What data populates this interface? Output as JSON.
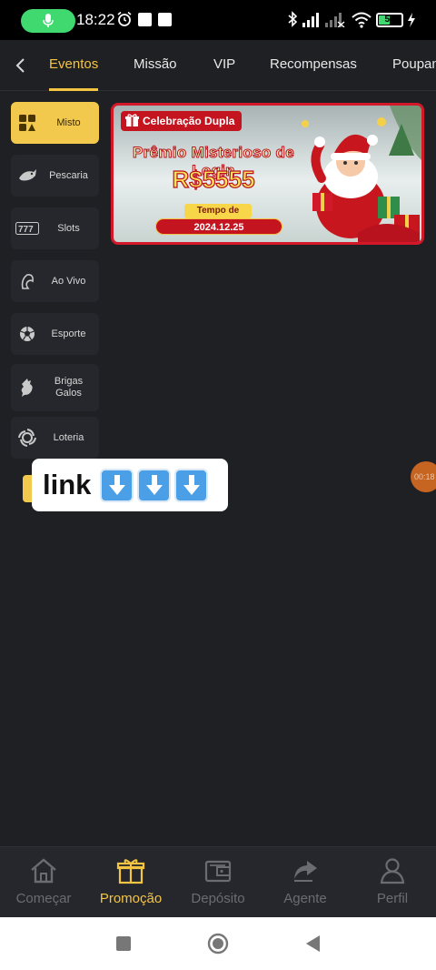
{
  "status_bar": {
    "time": "18:22",
    "battery_level": "50",
    "battery_fraction": 0.5,
    "icons": [
      "microphone-icon",
      "alarm-icon",
      "bluetooth-icon",
      "signal-icon",
      "wifi-icon",
      "charging-icon"
    ]
  },
  "top_nav": {
    "tabs": [
      {
        "label": "Eventos",
        "active": true
      },
      {
        "label": "Missão",
        "active": false
      },
      {
        "label": "VIP",
        "active": false
      },
      {
        "label": "Recompensas",
        "active": false
      },
      {
        "label": "Poupança",
        "active": false
      }
    ]
  },
  "sidebar": {
    "items": [
      {
        "label": "Misto",
        "icon": "grid-icon",
        "active": true
      },
      {
        "label": "Pescaria",
        "icon": "fish-icon",
        "active": false
      },
      {
        "label": "Slots",
        "icon": "slots-777-icon",
        "active": false
      },
      {
        "label": "Ao Vivo",
        "icon": "live-icon",
        "active": false
      },
      {
        "label": "Esporte",
        "icon": "soccer-ball-icon",
        "active": false
      },
      {
        "label": "Brigas Galos",
        "icon": "rooster-icon",
        "active": false
      },
      {
        "label": "Loteria",
        "icon": "lottery-icon",
        "active": false
      }
    ]
  },
  "banner": {
    "tag": "Celebração Dupla",
    "title": "Prêmio Misterioso de Login",
    "amount": "R$5555",
    "pill": "Tempo de coleta",
    "date": "2024.12.25"
  },
  "overlay": {
    "link_text": "link",
    "arrows": [
      "⬇",
      "⬇",
      "⬇"
    ]
  },
  "floating": {
    "timer_text": "00:18"
  },
  "bottom_nav": {
    "items": [
      {
        "label": "Começar",
        "icon": "home-icon",
        "active": false
      },
      {
        "label": "Promoção",
        "icon": "gift-icon",
        "active": true
      },
      {
        "label": "Depósito",
        "icon": "wallet-icon",
        "active": false
      },
      {
        "label": "Agente",
        "icon": "share-icon",
        "active": false
      },
      {
        "label": "Perfil",
        "icon": "user-icon",
        "active": false
      }
    ]
  },
  "colors": {
    "accent": "#f4c542",
    "background": "#1f2024",
    "banner_red": "#c4141f"
  }
}
